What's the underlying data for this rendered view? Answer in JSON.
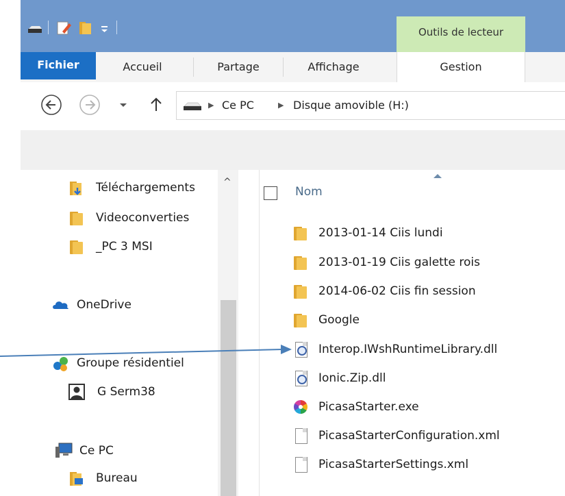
{
  "title_bar": {
    "contextual_tab": "Outils de lecteur",
    "quick_access_sep": "|"
  },
  "ribbon": {
    "tabs": [
      {
        "label": "Fichier"
      },
      {
        "label": "Accueil"
      },
      {
        "label": "Partage"
      },
      {
        "label": "Affichage"
      },
      {
        "label": "Gestion"
      }
    ]
  },
  "address": {
    "crumbs": [
      "Ce PC",
      "Disque amovible (H:)"
    ]
  },
  "nav_pane": {
    "items": [
      {
        "label": "Téléchargements",
        "icon": "downloads-folder-icon"
      },
      {
        "label": "Videoconverties",
        "icon": "folder-icon"
      },
      {
        "label": "_PC 3 MSI",
        "icon": "folder-icon"
      },
      {
        "label": "OneDrive",
        "icon": "onedrive-icon"
      },
      {
        "label": "Groupe résidentiel",
        "icon": "homegroup-icon"
      },
      {
        "label": "G Serm38",
        "icon": "user-icon"
      },
      {
        "label": "Ce PC",
        "icon": "computer-icon"
      },
      {
        "label": "Bureau",
        "icon": "desktop-folder-icon"
      }
    ]
  },
  "file_list": {
    "column_header": "Nom",
    "files": [
      {
        "name": "2013-01-14 Ciis lundi",
        "type": "folder"
      },
      {
        "name": "2013-01-19 Ciis galette rois",
        "type": "folder"
      },
      {
        "name": "2014-06-02 Ciis fin session",
        "type": "folder"
      },
      {
        "name": "Google",
        "type": "folder"
      },
      {
        "name": "Interop.IWshRuntimeLibrary.dll",
        "type": "dll"
      },
      {
        "name": "Ionic.Zip.dll",
        "type": "dll"
      },
      {
        "name": "PicasaStarter.exe",
        "type": "exe"
      },
      {
        "name": "PicasaStarterConfiguration.xml",
        "type": "xml"
      },
      {
        "name": "PicasaStarterSettings.xml",
        "type": "xml"
      }
    ]
  },
  "colors": {
    "title_bar": "#6f98cc",
    "contextual_tab": "#cdeab5",
    "file_tab": "#1c6fc5",
    "annotation_arrow": "#4a7fb8"
  }
}
